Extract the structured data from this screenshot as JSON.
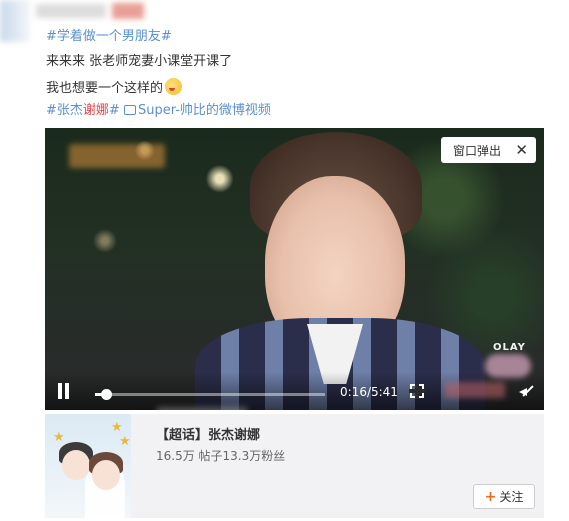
{
  "post": {
    "hashtag_top": "#学着做一个男朋友#",
    "line1": "来来来 张老师宠妻小课堂开课了",
    "line2": "我也想要一个这样的",
    "tag_part1": "#张杰",
    "tag_part2_red": "谢娜",
    "tag_part3": "#",
    "video_link": "Super-帅比的微博视频"
  },
  "video": {
    "popout_label": "窗口弹出",
    "close_glyph": "✕",
    "watermark": "OLAY",
    "current_time": "0:16",
    "duration": "5:41",
    "time_display": "0:16/5:41",
    "progress_fraction": 0.047
  },
  "topic_card": {
    "title": "【超话】张杰谢娜",
    "stats": "16.5万 帖子13.3万粉丝",
    "follow_label": "关注",
    "follow_glyph": "+"
  },
  "colors": {
    "link": "#5b8fd1",
    "highlight": "#e0434a",
    "follow_plus": "#e96a27"
  }
}
